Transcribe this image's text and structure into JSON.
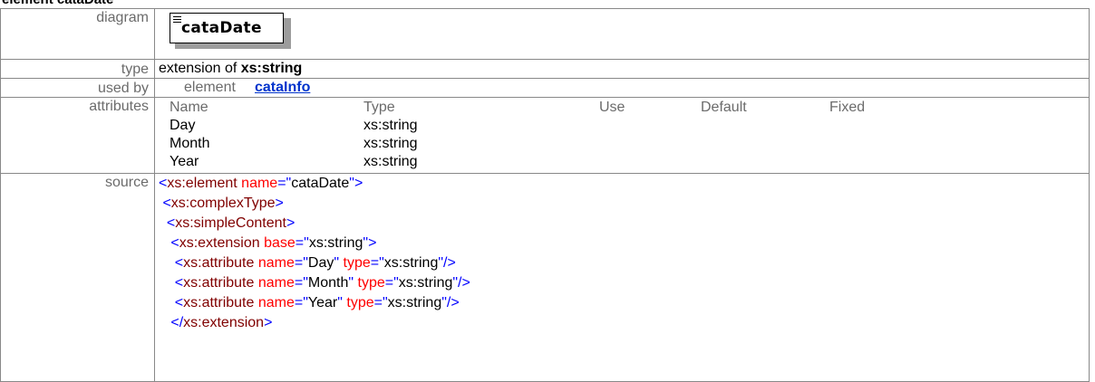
{
  "header": "element cataDate",
  "rows": {
    "diagram_label": "diagram",
    "type_label": "type",
    "usedby_label": "used by",
    "attributes_label": "attributes",
    "source_label": "source"
  },
  "diagram": {
    "element_name": "cataDate",
    "icon": "element-content-icon"
  },
  "type": {
    "prefix": "extension of ",
    "base": "xs:string"
  },
  "used_by": {
    "kind": "element",
    "link": "cataInfo"
  },
  "attributes": {
    "columns": [
      "Name",
      "Type",
      "Use",
      "Default",
      "Fixed"
    ],
    "rows": [
      {
        "name": "Day",
        "type": "xs:string"
      },
      {
        "name": "Month",
        "type": "xs:string"
      },
      {
        "name": "Year",
        "type": "xs:string"
      }
    ]
  },
  "source": {
    "l1_tag": "xs:element",
    "l1_attr": "name",
    "l1_val": "cataDate",
    "l2_tag": "xs:complexType",
    "l3_tag": "xs:simpleContent",
    "l4_tag": "xs:extension",
    "l4_attr": "base",
    "l4_val": "xs:string",
    "attr_tag": "xs:attribute",
    "a_name": "name",
    "a_type": "type",
    "a1_name": "Day",
    "a2_name": "Month",
    "a3_name": "Year",
    "a_type_val": "xs:string",
    "l8_tag": "xs:extension"
  },
  "colors": {
    "bracket": "#0000ff",
    "tag": "#800000",
    "attr": "#ff0000",
    "link": "#0033cc"
  }
}
